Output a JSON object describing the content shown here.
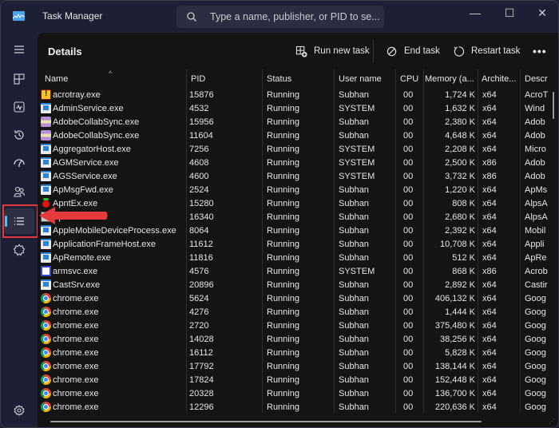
{
  "window": {
    "title": "Task Manager",
    "search_placeholder": "Type a name, publisher, or PID to se...",
    "controls": {
      "minimize": "—",
      "maximize": "☐",
      "close": "✕"
    }
  },
  "sidebar": {
    "items": [
      {
        "name": "hamburger-menu",
        "icon": "menu-icon"
      },
      {
        "name": "processes",
        "icon": "processes-icon"
      },
      {
        "name": "performance",
        "icon": "performance-icon"
      },
      {
        "name": "app-history",
        "icon": "history-icon"
      },
      {
        "name": "startup-apps",
        "icon": "startup-icon"
      },
      {
        "name": "users",
        "icon": "users-icon"
      },
      {
        "name": "details",
        "icon": "details-list-icon",
        "active": true
      },
      {
        "name": "services",
        "icon": "services-icon"
      },
      {
        "name": "settings",
        "icon": "gear-icon"
      }
    ],
    "accent": "#4cc2ff",
    "annotation_color": "#e5393d"
  },
  "page": {
    "title": "Details",
    "toolbar": {
      "run_new_task": "Run new task",
      "end_task": "End task",
      "restart_task": "Restart task",
      "more": "•••"
    }
  },
  "table": {
    "columns": {
      "name": "Name",
      "pid": "PID",
      "status": "Status",
      "user": "User name",
      "cpu": "CPU",
      "memory": "Memory (a...",
      "arch": "Archite...",
      "desc": "Descr"
    },
    "sort_indicator": "^",
    "rows": [
      {
        "icon": "acro",
        "name": "acrotray.exe",
        "pid": "15876",
        "status": "Running",
        "user": "Subhan",
        "cpu": "00",
        "memory": "1,724 K",
        "arch": "x64",
        "desc": "AcroT"
      },
      {
        "icon": "win",
        "name": "AdminService.exe",
        "pid": "4532",
        "status": "Running",
        "user": "SYSTEM",
        "cpu": "00",
        "memory": "1,632 K",
        "arch": "x64",
        "desc": "Wind"
      },
      {
        "icon": "adobe",
        "name": "AdobeCollabSync.exe",
        "pid": "15956",
        "status": "Running",
        "user": "Subhan",
        "cpu": "00",
        "memory": "2,380 K",
        "arch": "x64",
        "desc": "Adob"
      },
      {
        "icon": "adobe",
        "name": "AdobeCollabSync.exe",
        "pid": "11604",
        "status": "Running",
        "user": "Subhan",
        "cpu": "00",
        "memory": "4,648 K",
        "arch": "x64",
        "desc": "Adob"
      },
      {
        "icon": "win",
        "name": "AggregatorHost.exe",
        "pid": "7256",
        "status": "Running",
        "user": "SYSTEM",
        "cpu": "00",
        "memory": "2,208 K",
        "arch": "x64",
        "desc": "Micro"
      },
      {
        "icon": "win",
        "name": "AGMService.exe",
        "pid": "4608",
        "status": "Running",
        "user": "SYSTEM",
        "cpu": "00",
        "memory": "2,500 K",
        "arch": "x86",
        "desc": "Adob"
      },
      {
        "icon": "win",
        "name": "AGSService.exe",
        "pid": "4600",
        "status": "Running",
        "user": "SYSTEM",
        "cpu": "00",
        "memory": "3,732 K",
        "arch": "x86",
        "desc": "Adob"
      },
      {
        "icon": "win",
        "name": "ApMsgFwd.exe",
        "pid": "2524",
        "status": "Running",
        "user": "Subhan",
        "cpu": "00",
        "memory": "1,220 K",
        "arch": "x64",
        "desc": "ApMs"
      },
      {
        "icon": "apnt",
        "name": "ApntEx.exe",
        "pid": "15280",
        "status": "Running",
        "user": "Subhan",
        "cpu": "00",
        "memory": "808 K",
        "arch": "x64",
        "desc": "AlpsA"
      },
      {
        "icon": "apoint",
        "name": "Apoint.exe",
        "pid": "16340",
        "status": "Running",
        "user": "Subhan",
        "cpu": "00",
        "memory": "2,680 K",
        "arch": "x64",
        "desc": "AlpsA"
      },
      {
        "icon": "win",
        "name": "AppleMobileDeviceProcess.exe",
        "pid": "8064",
        "status": "Running",
        "user": "Subhan",
        "cpu": "00",
        "memory": "2,392 K",
        "arch": "x64",
        "desc": "Mobil"
      },
      {
        "icon": "win",
        "name": "ApplicationFrameHost.exe",
        "pid": "11612",
        "status": "Running",
        "user": "Subhan",
        "cpu": "00",
        "memory": "10,708 K",
        "arch": "x64",
        "desc": "Appli"
      },
      {
        "icon": "win",
        "name": "ApRemote.exe",
        "pid": "11816",
        "status": "Running",
        "user": "Subhan",
        "cpu": "00",
        "memory": "512 K",
        "arch": "x64",
        "desc": "ApRe"
      },
      {
        "icon": "arms",
        "name": "armsvc.exe",
        "pid": "4576",
        "status": "Running",
        "user": "SYSTEM",
        "cpu": "00",
        "memory": "868 K",
        "arch": "x86",
        "desc": "Acrob"
      },
      {
        "icon": "win",
        "name": "CastSrv.exe",
        "pid": "20896",
        "status": "Running",
        "user": "Subhan",
        "cpu": "00",
        "memory": "2,892 K",
        "arch": "x64",
        "desc": "Castir"
      },
      {
        "icon": "chrome",
        "name": "chrome.exe",
        "pid": "5624",
        "status": "Running",
        "user": "Subhan",
        "cpu": "00",
        "memory": "406,132 K",
        "arch": "x64",
        "desc": "Goog"
      },
      {
        "icon": "chrome",
        "name": "chrome.exe",
        "pid": "4276",
        "status": "Running",
        "user": "Subhan",
        "cpu": "00",
        "memory": "1,444 K",
        "arch": "x64",
        "desc": "Goog"
      },
      {
        "icon": "chrome",
        "name": "chrome.exe",
        "pid": "2720",
        "status": "Running",
        "user": "Subhan",
        "cpu": "00",
        "memory": "375,480 K",
        "arch": "x64",
        "desc": "Goog"
      },
      {
        "icon": "chrome",
        "name": "chrome.exe",
        "pid": "14028",
        "status": "Running",
        "user": "Subhan",
        "cpu": "00",
        "memory": "38,256 K",
        "arch": "x64",
        "desc": "Goog"
      },
      {
        "icon": "chrome",
        "name": "chrome.exe",
        "pid": "16112",
        "status": "Running",
        "user": "Subhan",
        "cpu": "00",
        "memory": "5,828 K",
        "arch": "x64",
        "desc": "Goog"
      },
      {
        "icon": "chrome",
        "name": "chrome.exe",
        "pid": "17792",
        "status": "Running",
        "user": "Subhan",
        "cpu": "00",
        "memory": "138,144 K",
        "arch": "x64",
        "desc": "Goog"
      },
      {
        "icon": "chrome",
        "name": "chrome.exe",
        "pid": "17824",
        "status": "Running",
        "user": "Subhan",
        "cpu": "00",
        "memory": "152,448 K",
        "arch": "x64",
        "desc": "Goog"
      },
      {
        "icon": "chrome",
        "name": "chrome.exe",
        "pid": "20328",
        "status": "Running",
        "user": "Subhan",
        "cpu": "00",
        "memory": "136,700 K",
        "arch": "x64",
        "desc": "Goog"
      },
      {
        "icon": "chrome",
        "name": "chrome.exe",
        "pid": "12296",
        "status": "Running",
        "user": "Subhan",
        "cpu": "00",
        "memory": "220,636 K",
        "arch": "x64",
        "desc": "Goog"
      }
    ]
  }
}
